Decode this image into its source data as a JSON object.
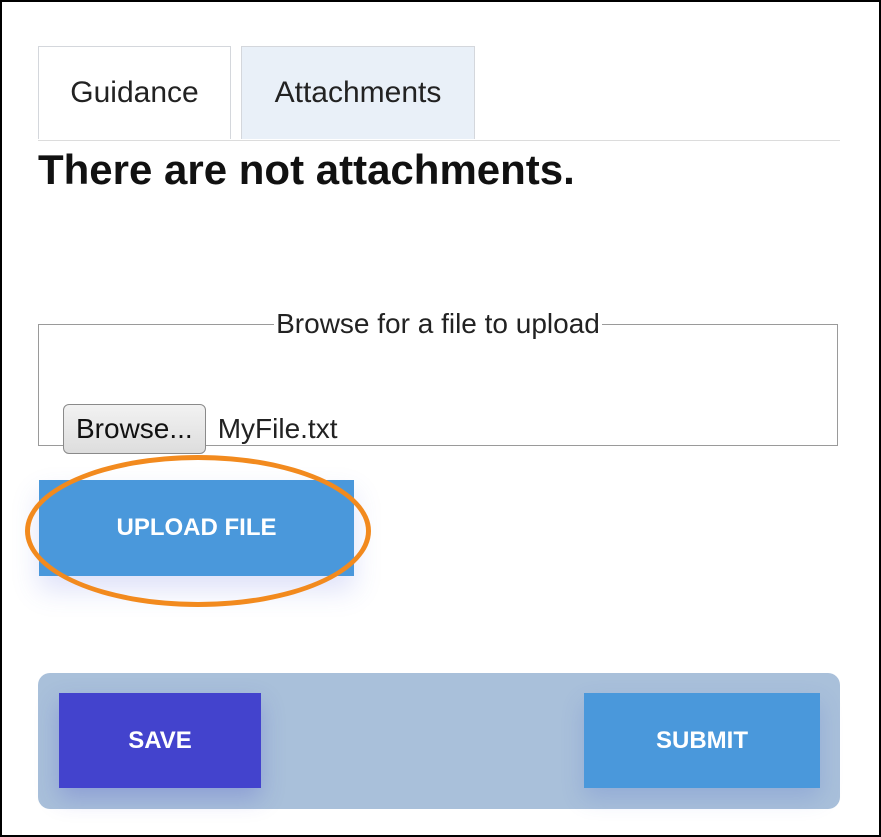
{
  "tabs": [
    {
      "label": "Guidance",
      "active": true
    },
    {
      "label": "Attachments",
      "active": false
    }
  ],
  "attachments": {
    "empty_message": "There are not attachments."
  },
  "upload": {
    "legend": "Browse for a file to upload",
    "browse_label": "Browse...",
    "selected_file": "MyFile.txt",
    "upload_label": "UPLOAD FILE"
  },
  "actions": {
    "save_label": "SAVE",
    "submit_label": "SUBMIT"
  },
  "colors": {
    "save_button": "#4343cd",
    "primary_button": "#4a98db",
    "action_bar": "#a9c0da",
    "highlight": "#f28a1e",
    "attachments_tab_bg": "#e9f0f8"
  }
}
